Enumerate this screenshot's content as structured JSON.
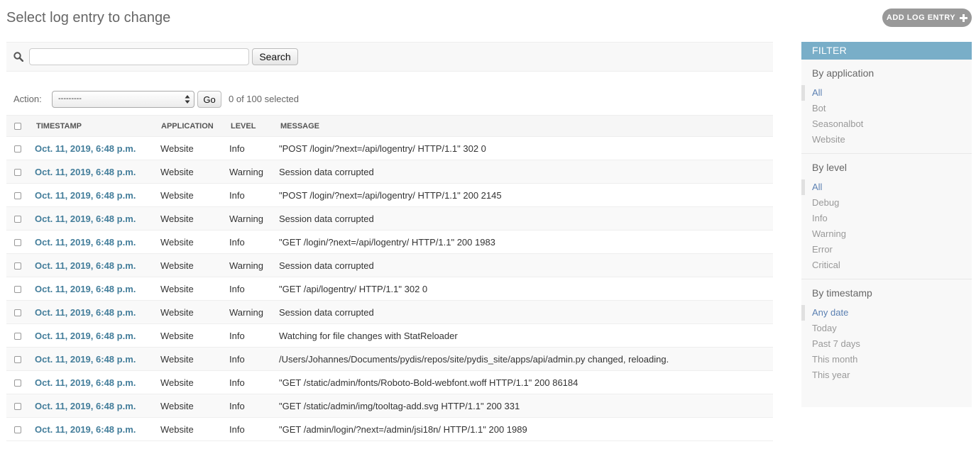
{
  "header": {
    "title": "Select log entry to change",
    "add_button_label": "ADD LOG ENTRY"
  },
  "search": {
    "value": "",
    "placeholder": "",
    "button_label": "Search"
  },
  "actions": {
    "label": "Action:",
    "selected_option": "---------",
    "go_label": "Go",
    "selected_count": "0 of 100 selected"
  },
  "table": {
    "columns": [
      "TIMESTAMP",
      "APPLICATION",
      "LEVEL",
      "MESSAGE"
    ],
    "rows": [
      {
        "timestamp": "Oct. 11, 2019, 6:48 p.m.",
        "application": "Website",
        "level": "Info",
        "message": "\"POST /login/?next=/api/logentry/ HTTP/1.1\" 302 0"
      },
      {
        "timestamp": "Oct. 11, 2019, 6:48 p.m.",
        "application": "Website",
        "level": "Warning",
        "message": "Session data corrupted"
      },
      {
        "timestamp": "Oct. 11, 2019, 6:48 p.m.",
        "application": "Website",
        "level": "Info",
        "message": "\"POST /login/?next=/api/logentry/ HTTP/1.1\" 200 2145"
      },
      {
        "timestamp": "Oct. 11, 2019, 6:48 p.m.",
        "application": "Website",
        "level": "Warning",
        "message": "Session data corrupted"
      },
      {
        "timestamp": "Oct. 11, 2019, 6:48 p.m.",
        "application": "Website",
        "level": "Info",
        "message": "\"GET /login/?next=/api/logentry/ HTTP/1.1\" 200 1983"
      },
      {
        "timestamp": "Oct. 11, 2019, 6:48 p.m.",
        "application": "Website",
        "level": "Warning",
        "message": "Session data corrupted"
      },
      {
        "timestamp": "Oct. 11, 2019, 6:48 p.m.",
        "application": "Website",
        "level": "Info",
        "message": "\"GET /api/logentry/ HTTP/1.1\" 302 0"
      },
      {
        "timestamp": "Oct. 11, 2019, 6:48 p.m.",
        "application": "Website",
        "level": "Warning",
        "message": "Session data corrupted"
      },
      {
        "timestamp": "Oct. 11, 2019, 6:48 p.m.",
        "application": "Website",
        "level": "Info",
        "message": "Watching for file changes with StatReloader"
      },
      {
        "timestamp": "Oct. 11, 2019, 6:48 p.m.",
        "application": "Website",
        "level": "Info",
        "message": "/Users/Johannes/Documents/pydis/repos/site/pydis_site/apps/api/admin.py changed, reloading."
      },
      {
        "timestamp": "Oct. 11, 2019, 6:48 p.m.",
        "application": "Website",
        "level": "Info",
        "message": "\"GET /static/admin/fonts/Roboto-Bold-webfont.woff HTTP/1.1\" 200 86184"
      },
      {
        "timestamp": "Oct. 11, 2019, 6:48 p.m.",
        "application": "Website",
        "level": "Info",
        "message": "\"GET /static/admin/img/tooltag-add.svg HTTP/1.1\" 200 331"
      },
      {
        "timestamp": "Oct. 11, 2019, 6:48 p.m.",
        "application": "Website",
        "level": "Info",
        "message": "\"GET /admin/login/?next=/admin/jsi18n/ HTTP/1.1\" 200 1989"
      }
    ]
  },
  "filter": {
    "header": "FILTER",
    "sections": [
      {
        "title": "By application",
        "options": [
          "All",
          "Bot",
          "Seasonalbot",
          "Website"
        ],
        "selected": 0
      },
      {
        "title": "By level",
        "options": [
          "All",
          "Debug",
          "Info",
          "Warning",
          "Error",
          "Critical"
        ],
        "selected": 0
      },
      {
        "title": "By timestamp",
        "options": [
          "Any date",
          "Today",
          "Past 7 days",
          "This month",
          "This year"
        ],
        "selected": 0
      }
    ]
  },
  "icons": {
    "search": "search-icon",
    "add": "plus-icon",
    "select": "select-arrows-icon"
  },
  "colors": {
    "link": "#447e9b",
    "filter_header": "#79aec8",
    "filter_selected": "#5b80b2",
    "add_button": "#999999"
  }
}
